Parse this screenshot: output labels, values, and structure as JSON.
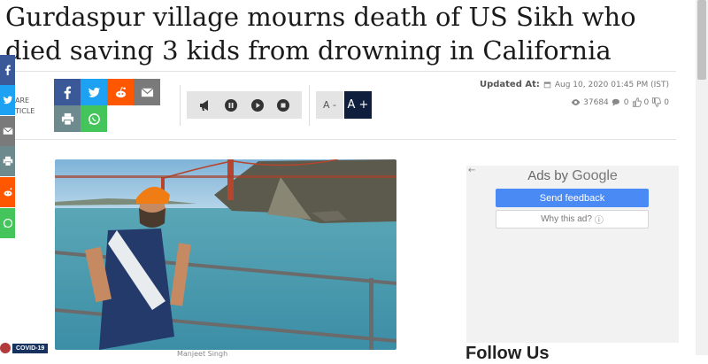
{
  "article": {
    "headline": "Gurdaspur village mourns death of US Sikh who died saving 3 kids from drowning in California",
    "updated_label": "Updated At:",
    "updated_value": "Aug 10, 2020 01:45 PM (IST)",
    "views": "37684",
    "comments": "0",
    "likes": "0",
    "dislikes": "0",
    "photo_caption": "Manjeet Singh"
  },
  "share": {
    "label_line1": "ARE",
    "label_line2": "TICLE",
    "buttons": [
      "facebook-icon",
      "twitter-icon",
      "reddit-icon",
      "email-icon",
      "print-icon",
      "whatsapp-icon"
    ]
  },
  "font_controls": {
    "decrease": "A -",
    "increase": "A +"
  },
  "ad": {
    "ads_by": "Ads by",
    "google": "Google",
    "send_feedback": "Send feedback",
    "why_this_ad": "Why this ad?"
  },
  "sidebar": {
    "follow_us": "Follow Us"
  },
  "covid_badge": "COVID-19",
  "colors": {
    "facebook": "#3b5998",
    "twitter": "#1da1f2",
    "reddit": "#ff5700",
    "email": "#7a7a7a",
    "print": "#6d8b8f",
    "whatsapp": "#43c55c",
    "font_increase_bg": "#0f1e3d",
    "ad_button": "#4a8af4"
  }
}
